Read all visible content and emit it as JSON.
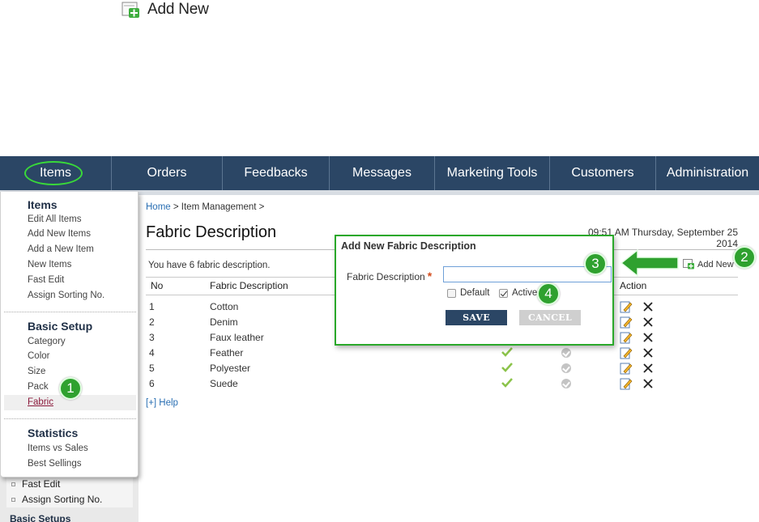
{
  "top_callout": {
    "label": "Add New",
    "icon": "add-new-icon"
  },
  "nav": {
    "items": [
      {
        "label": "Items"
      },
      {
        "label": "Orders"
      },
      {
        "label": "Feedbacks"
      },
      {
        "label": "Messages"
      },
      {
        "label": "Marketing Tools"
      },
      {
        "label": "Customers"
      },
      {
        "label": "Administration"
      }
    ]
  },
  "dropdown": {
    "items_heading": "Items",
    "items": [
      "Edit All Items",
      "Add New Items",
      "Add a New Item",
      "New Items",
      "Fast Edit",
      "Assign Sorting No."
    ],
    "basic_heading": "Basic Setup",
    "basic": [
      "Category",
      "Color",
      "Size",
      "Pack",
      "Fabric"
    ],
    "stats_heading": "Statistics",
    "stats": [
      "Items vs Sales",
      "Best Sellings"
    ]
  },
  "background_sidebar": {
    "rows": [
      "Fast Edit",
      "Assign Sorting No."
    ],
    "heading": "Basic Setups"
  },
  "breadcrumb": {
    "home": "Home",
    "sep1": " > ",
    "current": "Item Management >"
  },
  "page": {
    "title": "Fabric Description",
    "timestamp": "09:51 AM Thursday, September 25 2014",
    "count_text": "You have 6 fabric description.",
    "add_new_label": "Add New",
    "help": "[+] Help"
  },
  "table": {
    "headers": {
      "no": "No",
      "desc": "Fabric Description",
      "action": "Action"
    },
    "rows": [
      {
        "no": "1",
        "desc": "Cotton"
      },
      {
        "no": "2",
        "desc": "Denim"
      },
      {
        "no": "3",
        "desc": "Faux leather"
      },
      {
        "no": "4",
        "desc": "Feather"
      },
      {
        "no": "5",
        "desc": "Polyester"
      },
      {
        "no": "6",
        "desc": "Suede"
      }
    ]
  },
  "modal": {
    "title": "Add New Fabric Description",
    "field_label": "Fabric Description",
    "required_mark": "*",
    "field_value": "",
    "default_label": "Default",
    "active_label": "Active",
    "default_checked": false,
    "active_checked": true,
    "save": "SAVE",
    "cancel": "CANCEL"
  },
  "steps": [
    "1",
    "2",
    "3",
    "4"
  ],
  "colors": {
    "nav": "#2b4665",
    "accent_green": "#2fa12f",
    "link": "#2a6fb3",
    "check": "#8bc34a"
  }
}
